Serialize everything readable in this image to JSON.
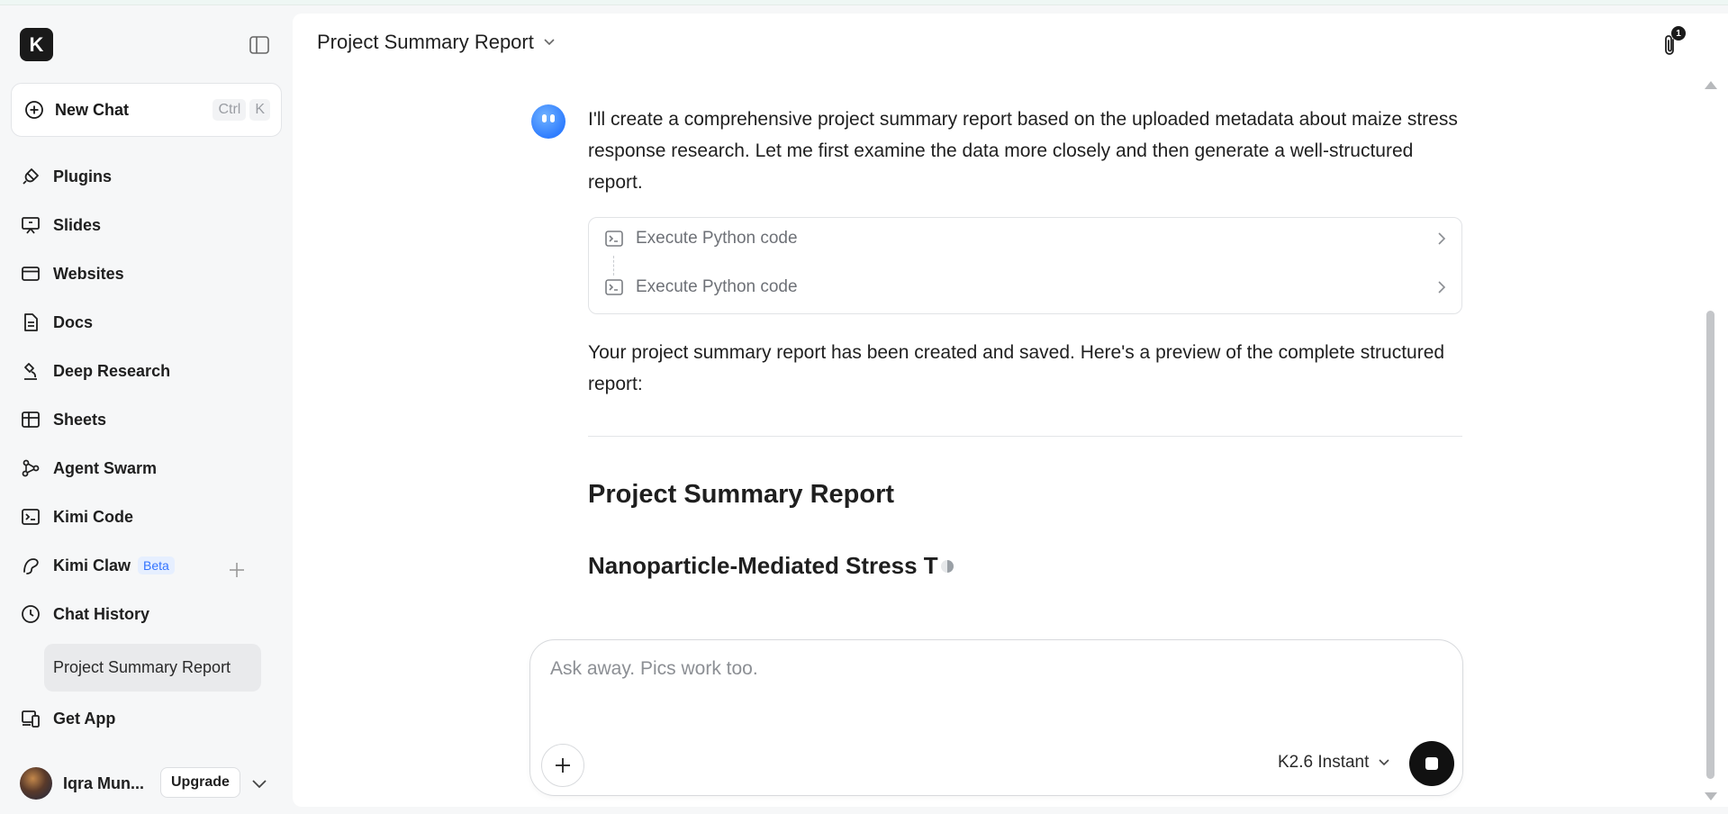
{
  "app": {
    "logo_letter": "K"
  },
  "sidebar": {
    "new_chat": {
      "label": "New Chat",
      "shortcut": [
        "Ctrl",
        "K"
      ]
    },
    "items": [
      {
        "label": "Plugins",
        "icon": "plug-icon"
      },
      {
        "label": "Slides",
        "icon": "presentation-icon"
      },
      {
        "label": "Websites",
        "icon": "browser-icon"
      },
      {
        "label": "Docs",
        "icon": "document-icon"
      },
      {
        "label": "Deep Research",
        "icon": "microscope-icon"
      },
      {
        "label": "Sheets",
        "icon": "table-icon"
      },
      {
        "label": "Agent Swarm",
        "icon": "swarm-icon"
      },
      {
        "label": "Kimi Code",
        "icon": "terminal-icon"
      },
      {
        "label": "Kimi Claw",
        "icon": "claw-icon",
        "badge": "Beta"
      },
      {
        "label": "Chat History",
        "icon": "clock-icon"
      }
    ],
    "history": [
      "Project Summary Report"
    ],
    "get_app": "Get App",
    "user": {
      "name": "Iqra Mun...",
      "upgrade_label": "Upgrade"
    }
  },
  "header": {
    "title": "Project Summary Report",
    "attachments_count": "1"
  },
  "conversation": {
    "intro": "I'll create a comprehensive project summary report based on the uploaded metadata about maize stress response research. Let me first examine the data more closely and then generate a well-structured report.",
    "tool_calls": [
      "Execute Python code",
      "Execute Python code"
    ],
    "after_tools": "Your project summary report has been created and saved. Here's a preview of the complete structured report:",
    "report_title": "Project Summary Report",
    "report_subtitle": "Nanoparticle-Mediated Stress T"
  },
  "composer": {
    "placeholder": "Ask away. Pics work too.",
    "model": "K2.6 Instant"
  },
  "colors": {
    "accent": "#3474ff",
    "bot_avatar": "#2f7dff",
    "background": "#f6f7f8"
  }
}
